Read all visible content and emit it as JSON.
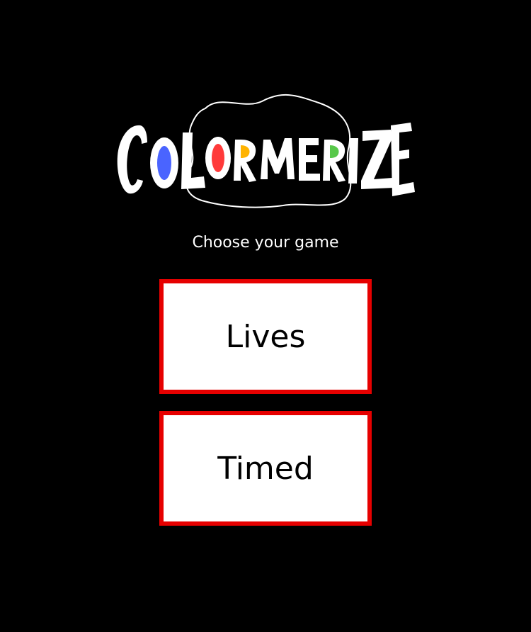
{
  "logo": {
    "text": "COLORMERIZE",
    "letters": [
      {
        "char": "C",
        "fill": "#ffffff"
      },
      {
        "char": "O",
        "fill": "#ffffff",
        "accent": "#4a64ff"
      },
      {
        "char": "L",
        "fill": "#ffffff"
      },
      {
        "char": "O",
        "fill": "#ffffff",
        "accent": "#ff3a3a"
      },
      {
        "char": "R",
        "fill": "#ffffff",
        "accent": "#ffb300"
      },
      {
        "char": "M",
        "fill": "#ffffff"
      },
      {
        "char": "E",
        "fill": "#ffffff"
      },
      {
        "char": "R",
        "fill": "#ffffff",
        "accent": "#58c84a"
      },
      {
        "char": "I",
        "fill": "#ffffff"
      },
      {
        "char": "Z",
        "fill": "#ffffff"
      },
      {
        "char": "E",
        "fill": "#ffffff"
      }
    ]
  },
  "subtitle": "Choose your game",
  "modes": {
    "lives_label": "Lives",
    "timed_label": "Timed"
  },
  "colors": {
    "background": "#000000",
    "button_border": "#e60000",
    "button_fill": "#ffffff"
  }
}
